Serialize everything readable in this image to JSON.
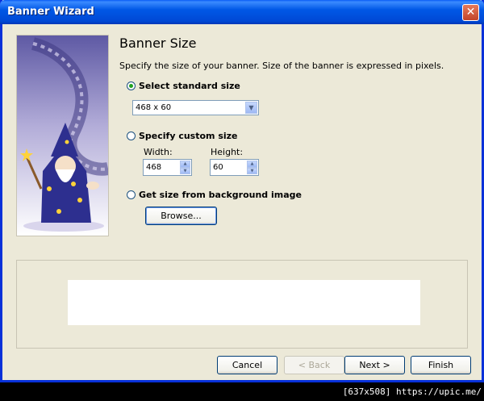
{
  "window": {
    "title": "Banner Wizard"
  },
  "page": {
    "heading": "Banner Size",
    "description": "Specify the size of your banner. Size of the banner is expressed in pixels."
  },
  "options": {
    "standard": {
      "label": "Select standard size",
      "selected": true,
      "value": "468 x 60"
    },
    "custom": {
      "label": "Specify custom size",
      "width_label": "Width:",
      "width_value": "468",
      "height_label": "Height:",
      "height_value": "60"
    },
    "background": {
      "label": "Get size from background image",
      "browse_label": "Browse..."
    }
  },
  "buttons": {
    "cancel": "Cancel",
    "back": "< Back",
    "next": "Next >",
    "finish": "Finish"
  },
  "watermark": "[637x508] https://upic.me/"
}
